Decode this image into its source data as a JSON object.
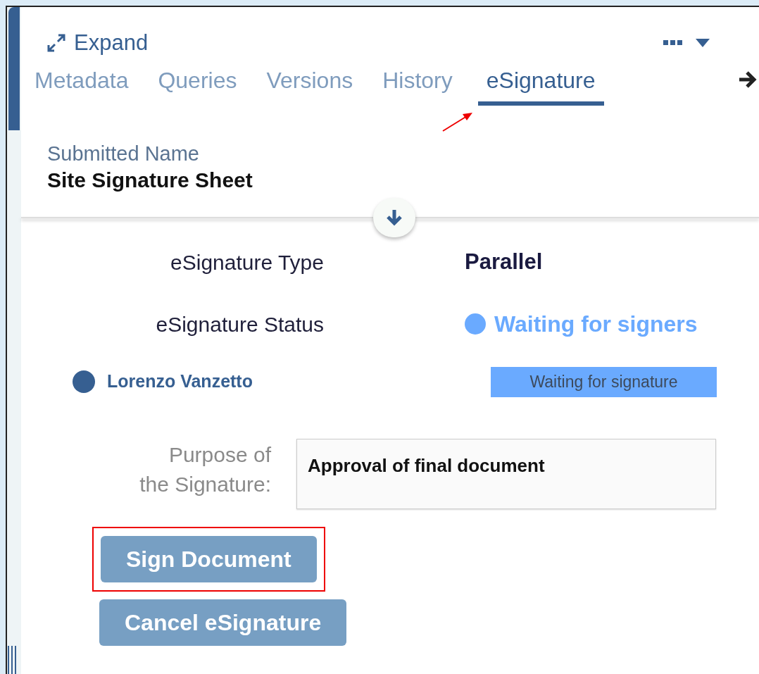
{
  "header": {
    "expand_label": "Expand"
  },
  "tabs": [
    {
      "label": "Metadata",
      "selected": false
    },
    {
      "label": "Queries",
      "selected": false
    },
    {
      "label": "Versions",
      "selected": false
    },
    {
      "label": "History",
      "selected": false
    },
    {
      "label": "eSignature",
      "selected": true
    }
  ],
  "submitted_name": {
    "label": "Submitted Name",
    "value": "Site Signature Sheet"
  },
  "fields": [
    {
      "label": "eSignature Type",
      "value": "Parallel",
      "kind": "text"
    },
    {
      "label": "eSignature Status",
      "value": "Waiting for signers",
      "kind": "status",
      "color": "#6aaaff"
    }
  ],
  "signers": [
    {
      "name": "Lorenzo Vanzetto",
      "color": "#365f91",
      "status": "Waiting for signature"
    }
  ],
  "purpose": {
    "label": "Purpose of the Signature:",
    "value": "Approval of final document"
  },
  "buttons": [
    {
      "label": "Sign Document",
      "highlighted": true
    },
    {
      "label": "Cancel eSignature",
      "highlighted": false
    }
  ]
}
